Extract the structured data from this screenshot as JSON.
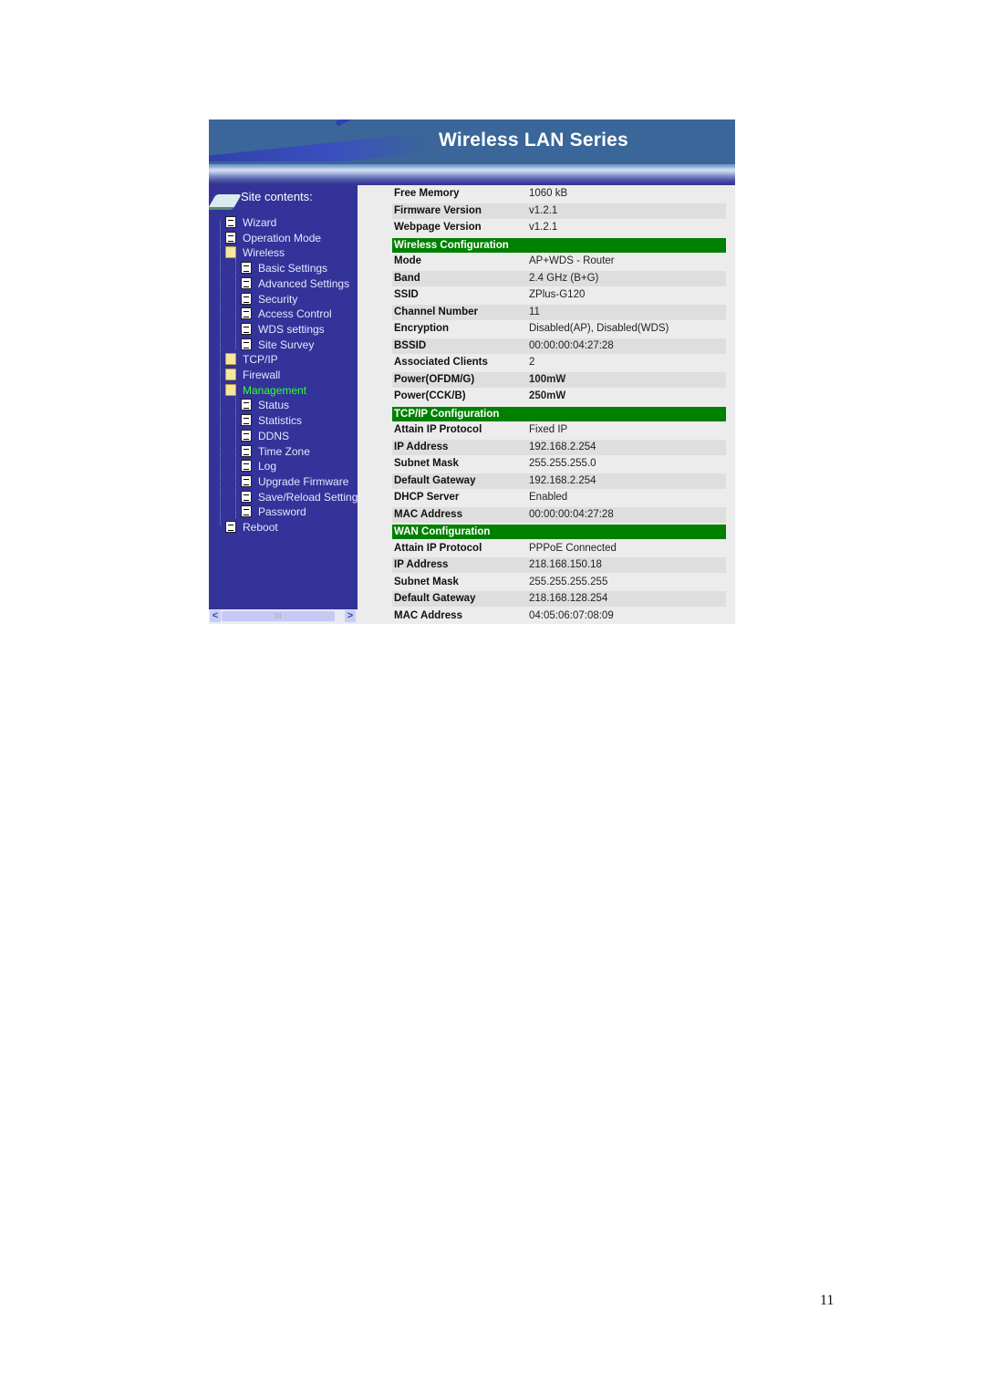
{
  "banner": {
    "title": "Wireless LAN Series"
  },
  "sidebar": {
    "heading": "Site contents:",
    "items": [
      {
        "label": "Wizard",
        "icon": "document-icon",
        "level": 1
      },
      {
        "label": "Operation Mode",
        "icon": "document-icon",
        "level": 1
      },
      {
        "label": "Wireless",
        "icon": "folder-open-icon",
        "level": 1
      },
      {
        "label": "Basic Settings",
        "icon": "document-icon",
        "level": 2
      },
      {
        "label": "Advanced Settings",
        "icon": "document-icon",
        "level": 2
      },
      {
        "label": "Security",
        "icon": "document-icon",
        "level": 2
      },
      {
        "label": "Access Control",
        "icon": "document-icon",
        "level": 2
      },
      {
        "label": "WDS settings",
        "icon": "document-icon",
        "level": 2
      },
      {
        "label": "Site Survey",
        "icon": "document-icon",
        "level": 2
      },
      {
        "label": "TCP/IP",
        "icon": "folder-icon",
        "level": 1
      },
      {
        "label": "Firewall",
        "icon": "folder-icon",
        "level": 1
      },
      {
        "label": "Management",
        "icon": "folder-open-icon",
        "level": 1,
        "active": true
      },
      {
        "label": "Status",
        "icon": "document-icon",
        "level": 2
      },
      {
        "label": "Statistics",
        "icon": "document-icon",
        "level": 2
      },
      {
        "label": "DDNS",
        "icon": "document-icon",
        "level": 2
      },
      {
        "label": "Time Zone",
        "icon": "document-icon",
        "level": 2
      },
      {
        "label": "Log",
        "icon": "document-icon",
        "level": 2
      },
      {
        "label": "Upgrade Firmware",
        "icon": "document-icon",
        "level": 2
      },
      {
        "label": "Save/Reload Setting",
        "icon": "document-icon",
        "level": 2
      },
      {
        "label": "Password",
        "icon": "document-icon",
        "level": 2
      },
      {
        "label": "Reboot",
        "icon": "document-icon",
        "level": 1
      }
    ],
    "scroll": {
      "left": "<",
      "right": ">",
      "thumb": "III"
    }
  },
  "status": {
    "system": [
      {
        "label": "Free Memory",
        "value": "1060 kB"
      },
      {
        "label": "Firmware Version",
        "value": "v1.2.1"
      },
      {
        "label": "Webpage Version",
        "value": "v1.2.1"
      }
    ],
    "wireless": {
      "title": "Wireless Configuration",
      "rows": [
        {
          "label": "Mode",
          "value": "AP+WDS - Router"
        },
        {
          "label": "Band",
          "value": "2.4 GHz (B+G)"
        },
        {
          "label": "SSID",
          "value": "ZPlus-G120"
        },
        {
          "label": "Channel Number",
          "value": "11"
        },
        {
          "label": "Encryption",
          "value": "Disabled(AP), Disabled(WDS)"
        },
        {
          "label": "BSSID",
          "value": "00:00:00:04:27:28"
        },
        {
          "label": "Associated Clients",
          "value": "2"
        },
        {
          "label": "Power(OFDM/G)",
          "value": "100mW",
          "bold": true
        },
        {
          "label": "Power(CCK/B)",
          "value": "250mW",
          "bold": true
        }
      ]
    },
    "tcpip": {
      "title": "TCP/IP Configuration",
      "rows": [
        {
          "label": "Attain IP Protocol",
          "value": "Fixed IP"
        },
        {
          "label": "IP Address",
          "value": "192.168.2.254"
        },
        {
          "label": "Subnet Mask",
          "value": "255.255.255.0"
        },
        {
          "label": "Default Gateway",
          "value": "192.168.2.254"
        },
        {
          "label": "DHCP Server",
          "value": "Enabled"
        },
        {
          "label": "MAC Address",
          "value": "00:00:00:04:27:28"
        }
      ]
    },
    "wan": {
      "title": "WAN Configuration",
      "rows": [
        {
          "label": "Attain IP Protocol",
          "value": "PPPoE Connected"
        },
        {
          "label": "IP Address",
          "value": "218.168.150.18"
        },
        {
          "label": "Subnet Mask",
          "value": "255.255.255.255"
        },
        {
          "label": "Default Gateway",
          "value": "218.168.128.254"
        },
        {
          "label": "MAC Address",
          "value": "04:05:06:07:08:09"
        }
      ]
    }
  },
  "colors": {
    "sidebar_bg": "#333399",
    "section_bg": "#008000",
    "active_item": "#33ff33",
    "banner_bg": "#3a6699"
  },
  "page": {
    "number": "11"
  }
}
